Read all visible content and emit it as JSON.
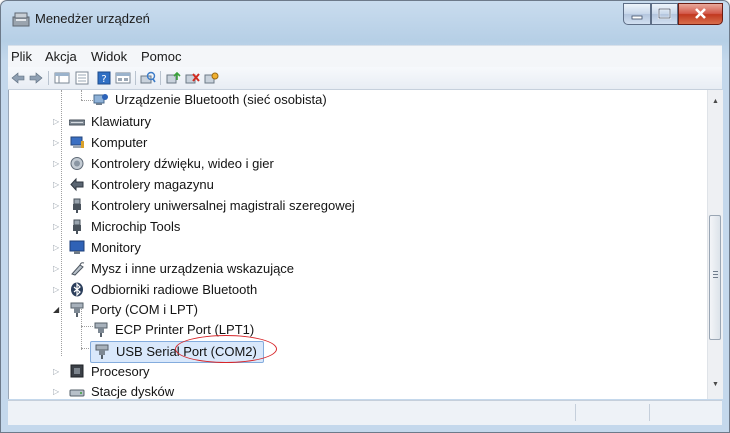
{
  "window": {
    "title": "Menedżer urządzeń"
  },
  "menu": [
    "Plik",
    "Akcja",
    "Widok",
    "Pomoc"
  ],
  "toolbar": [
    "back-arrow-icon",
    "forward-arrow-icon",
    "show-hide-tree-icon",
    "properties-icon",
    "help-icon",
    "view-icon",
    "scan-hardware-icon",
    "update-driver-icon",
    "uninstall-icon",
    "disable-icon"
  ],
  "tree": {
    "items": [
      {
        "label": "Urządzenie Bluetooth (sieć osobista)",
        "icon": "bluetooth-network-icon",
        "level": 2
      },
      {
        "label": "Klawiatury",
        "icon": "keyboard-icon",
        "level": 1
      },
      {
        "label": "Komputer",
        "icon": "computer-icon",
        "level": 1
      },
      {
        "label": "Kontrolery dźwięku, wideo i gier",
        "icon": "sound-controller-icon",
        "level": 1
      },
      {
        "label": "Kontrolery magazynu",
        "icon": "storage-controller-icon",
        "level": 1
      },
      {
        "label": "Kontrolery uniwersalnej magistrali szeregowej",
        "icon": "usb-controller-icon",
        "level": 1
      },
      {
        "label": "Microchip Tools",
        "icon": "usb-device-icon",
        "level": 1
      },
      {
        "label": "Monitory",
        "icon": "monitor-icon",
        "level": 1
      },
      {
        "label": "Mysz i inne urządzenia wskazujące",
        "icon": "mouse-icon",
        "level": 1
      },
      {
        "label": "Odbiorniki radiowe Bluetooth",
        "icon": "bluetooth-radio-icon",
        "level": 1
      },
      {
        "label": "Porty (COM i LPT)",
        "icon": "port-icon",
        "level": 1
      },
      {
        "label": "ECP Printer Port (LPT1)",
        "icon": "port-icon",
        "level": 2
      },
      {
        "label": "USB Serial Port (COM2)",
        "icon": "port-icon",
        "level": 2
      },
      {
        "label": "Procesory",
        "icon": "processor-icon",
        "level": 1
      },
      {
        "label": "Stacje dysków",
        "icon": "disk-drive-icon",
        "level": 1
      }
    ]
  },
  "colors": {
    "highlight": "#d7262a",
    "selection": "#d9e8fb"
  }
}
